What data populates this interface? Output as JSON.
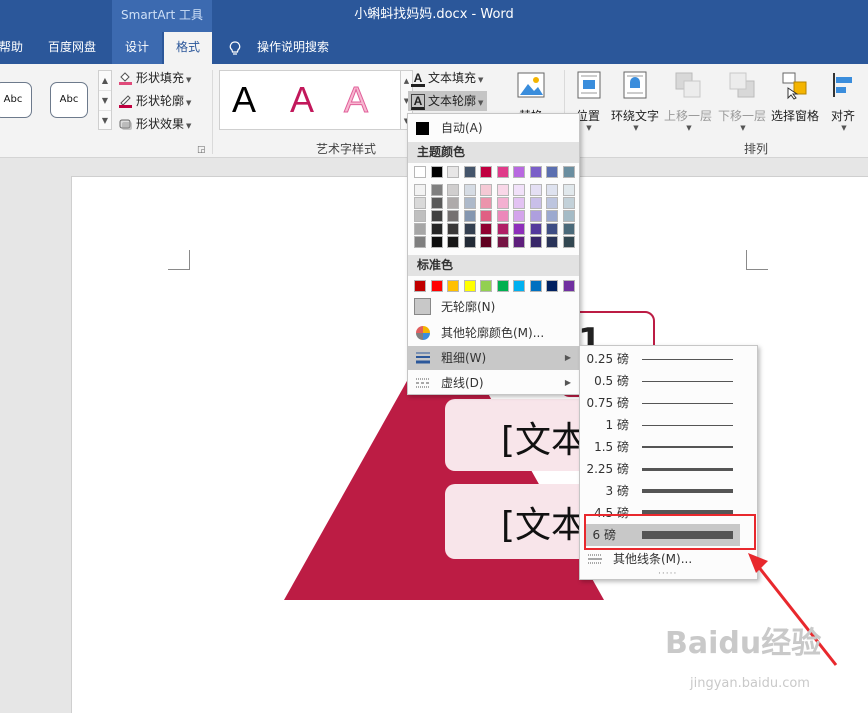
{
  "window": {
    "smartart_tools": "SmartArt 工具",
    "doc_title": "小蝌蚪找妈妈.docx  -  Word"
  },
  "tabs": {
    "help": "帮助",
    "baidu": "百度网盘",
    "design": "设计",
    "format": "格式",
    "tell_me": "操作说明搜索"
  },
  "ribbon": {
    "shape_styles": {
      "abc1": "Abc",
      "abc2": "Abc"
    },
    "shape_fill": "形状填充",
    "shape_outline": "形状轮廓",
    "shape_effects": "形状效果",
    "wordart_letter": "A",
    "text_fill": "文本填充",
    "text_outline": "文本轮廓",
    "wordart_group": "艺术字样式",
    "replace": "替换",
    "position": "位置",
    "wrap_text": "环绕文字",
    "bring_forward": "上移一层",
    "send_backward": "下移一层",
    "selection_pane": "选择窗格",
    "align": "对齐",
    "arrange_group": "排列"
  },
  "outline_menu": {
    "automatic": "自动(A)",
    "theme_colors_header": "主题颜色",
    "standard_colors_header": "标准色",
    "no_outline": "无轮廓(N)",
    "more_colors": "其他轮廓颜色(M)...",
    "weight": "粗细(W)",
    "dashes": "虚线(D)",
    "theme_top_row": [
      "#ffffff",
      "#000000",
      "#e7e6e6",
      "#44546a",
      "#c00040",
      "#e03c8a",
      "#b868e0",
      "#7a5fc8",
      "#5b6fb0",
      "#6a8ea0"
    ],
    "theme_shade_cols": [
      [
        "#f2f2f2",
        "#d9d9d9",
        "#bfbfbf",
        "#a6a6a6",
        "#7f7f7f"
      ],
      [
        "#7f7f7f",
        "#595959",
        "#404040",
        "#262626",
        "#0d0d0d"
      ],
      [
        "#d0cece",
        "#aeaaaa",
        "#757171",
        "#3a3838",
        "#171616"
      ],
      [
        "#d6dce4",
        "#adb9ca",
        "#8496b0",
        "#333f50",
        "#222a35"
      ],
      [
        "#f5c9d5",
        "#eb94ac",
        "#e05f83",
        "#900030",
        "#600020"
      ],
      [
        "#f9d7e8",
        "#f3b0d1",
        "#ec88ba",
        "#b01f66",
        "#751444"
      ],
      [
        "#f1e1f9",
        "#e3c3f3",
        "#d4a4ec",
        "#8d2fba",
        "#5e1f7c"
      ],
      [
        "#e4dff4",
        "#c9bfe9",
        "#ae9fde",
        "#543a9c",
        "#382768"
      ],
      [
        "#dee2ef",
        "#bdc5df",
        "#9ca9cf",
        "#3e4d84",
        "#293358"
      ],
      [
        "#e1e8ec",
        "#c3d1d9",
        "#a5bbc6",
        "#4b6a7a",
        "#324751"
      ]
    ],
    "standard": [
      "#c00000",
      "#ff0000",
      "#ffc000",
      "#ffff00",
      "#92d050",
      "#00b050",
      "#00b0f0",
      "#0070c0",
      "#002060",
      "#7030a0"
    ]
  },
  "weight_menu": {
    "items": [
      "0.25 磅",
      "0.5 磅",
      "0.75 磅",
      "1 磅",
      "1.5 磅",
      "2.25 磅",
      "3 磅",
      "4.5 磅",
      "6 磅"
    ],
    "thickness_pt": [
      0.25,
      0.5,
      0.75,
      1,
      1.5,
      2.25,
      3,
      4.5,
      6
    ],
    "selected": "6 磅",
    "more_lines": "其他线条(M)..."
  },
  "document": {
    "pyramid_text": "[文本",
    "pyramid_color": "#bc1c44",
    "partial_digit": "1"
  },
  "watermark": {
    "brand": "Baidu经验",
    "url": "jingyan.baidu.com"
  },
  "colors": {
    "word_blue": "#2b579a",
    "highlight_red": "#e8282d"
  }
}
